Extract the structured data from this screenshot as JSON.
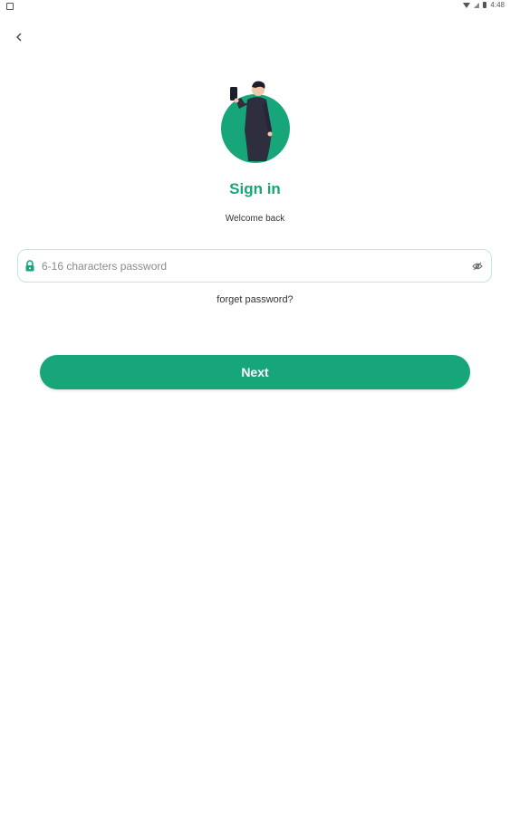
{
  "status_bar": {
    "time": "4:48",
    "icons": [
      "notification-icon",
      "wifi-icon",
      "signal-icon",
      "battery-icon"
    ]
  },
  "nav": {
    "back_icon": "chevron-left-icon"
  },
  "illustration": {
    "icon": "person-with-phone-illustration",
    "circle_color": "#17a57a"
  },
  "header": {
    "title": "Sign in",
    "subtitle": "Welcome back"
  },
  "password": {
    "placeholder": "6-16 characters password",
    "value": "",
    "lock_icon": "lock-icon",
    "toggle_icon": "eye-off-icon"
  },
  "links": {
    "forgot": "forget password?"
  },
  "actions": {
    "next_label": "Next"
  },
  "colors": {
    "accent": "#17a57a",
    "field_border": "#bfe9da"
  }
}
